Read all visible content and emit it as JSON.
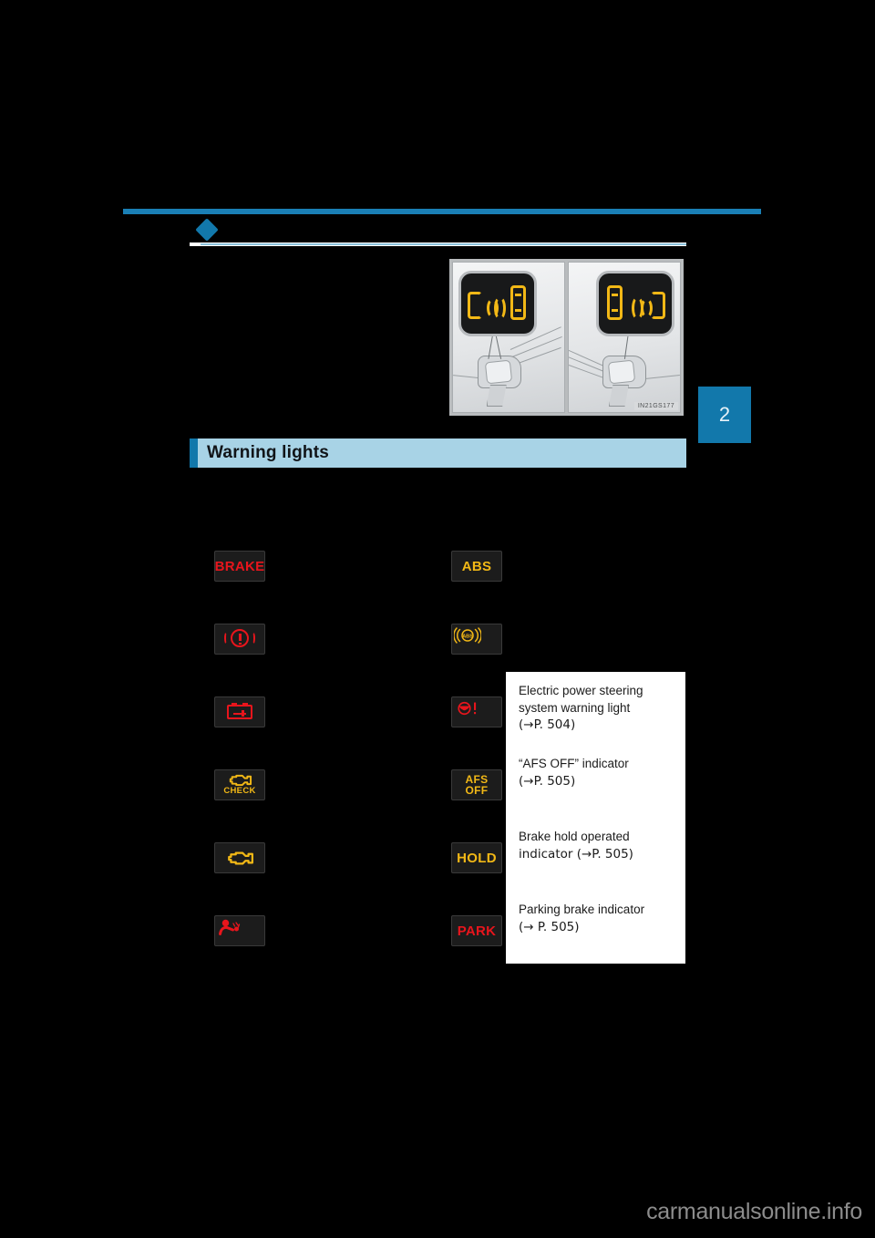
{
  "document": {
    "chapter_tab": "2",
    "illustration_caption": "IN21GS177",
    "watermark": "carmanualsonline.info"
  },
  "section": {
    "title": "Warning lights"
  },
  "warning_lights": {
    "left_column": [
      {
        "id": "brake-system-text",
        "label": "BRAKE",
        "kind": "text",
        "color": "#e8151c"
      },
      {
        "id": "brake-system-symbol",
        "label": "",
        "kind": "glyph-brake",
        "color": "#e8151c"
      },
      {
        "id": "charging-system",
        "label": "",
        "kind": "glyph-battery",
        "color": "#e8151c"
      },
      {
        "id": "malfunction-indicator-check",
        "label": "CHECK",
        "kind": "glyph-engine-check",
        "color": "#f2b816"
      },
      {
        "id": "malfunction-indicator",
        "label": "",
        "kind": "glyph-engine",
        "color": "#f2b816"
      },
      {
        "id": "srs-warning",
        "label": "",
        "kind": "glyph-srs",
        "color": "#e8151c"
      }
    ],
    "right_column": [
      {
        "id": "abs-text",
        "label": "ABS",
        "kind": "text",
        "color": "#f2b816"
      },
      {
        "id": "abs-symbol",
        "label": "ABS",
        "kind": "glyph-abs",
        "color": "#f2b816"
      },
      {
        "id": "eps-warning",
        "label": "",
        "kind": "glyph-eps",
        "color": "#e8151c"
      },
      {
        "id": "afs-off",
        "label": "AFS\nOFF",
        "label_line1": "AFS",
        "label_line2": "OFF",
        "kind": "text-two-line",
        "color": "#f2b816"
      },
      {
        "id": "brake-hold",
        "label": "HOLD",
        "kind": "text",
        "color": "#f2b816"
      },
      {
        "id": "parking-brake",
        "label": "PARK",
        "kind": "text",
        "color": "#e8151c"
      }
    ]
  },
  "overlay_panel": {
    "items": [
      {
        "text": "Electric power steering system warning light",
        "reference": "(→P. 504)"
      },
      {
        "text": "“AFS OFF” indicator",
        "reference": "(→P. 505)"
      },
      {
        "text": "Brake hold operated indicator",
        "reference": "(→P. 505)"
      },
      {
        "text": "Parking brake indicator",
        "reference": "(→ P. 505)"
      }
    ],
    "item_1_line1": "Electric   power   steering",
    "item_1_line2": "system warning light",
    "item_1_line3": "(→P. 504)",
    "item_2_line1": "“AFS OFF” indicator",
    "item_2_line2": "(→P. 505)",
    "item_3_line1": "Brake hold operated",
    "item_3_line2": "indicator (→P. 505)",
    "item_4_line1": "Parking brake indicator",
    "item_4_line2": "(→ P. 505)"
  },
  "colors": {
    "accent_blue": "#1278ab",
    "header_bar": "#a8d3e6",
    "warning_red": "#e8151c",
    "warning_amber": "#f2b816",
    "page_background": "#000000"
  }
}
